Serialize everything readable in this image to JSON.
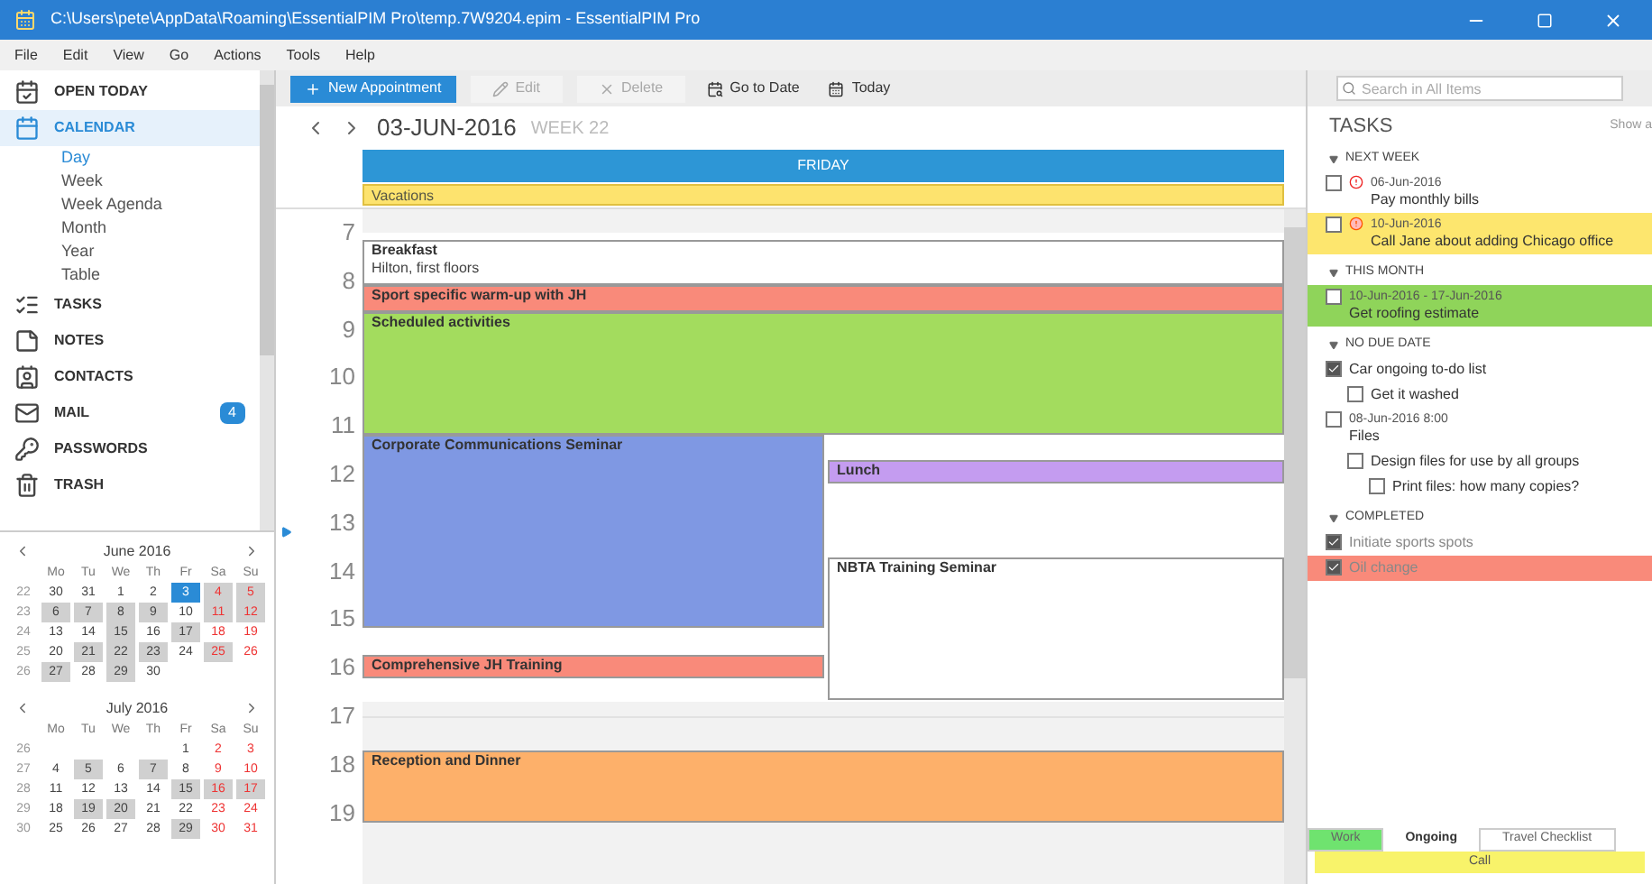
{
  "window": {
    "title": "C:\\Users\\pete\\AppData\\Roaming\\EssentialPIM Pro\\temp.7W9204.epim - EssentialPIM Pro"
  },
  "menu": [
    "File",
    "Edit",
    "View",
    "Go",
    "Actions",
    "Tools",
    "Help"
  ],
  "sidebar": {
    "items": [
      {
        "label": "OPEN TODAY",
        "kind": "module",
        "selected": false
      },
      {
        "label": "CALENDAR",
        "kind": "module",
        "selected": true
      },
      {
        "label": "Day",
        "kind": "view",
        "selected": true
      },
      {
        "label": "Week",
        "kind": "view",
        "selected": false
      },
      {
        "label": "Week Agenda",
        "kind": "view",
        "selected": false
      },
      {
        "label": "Month",
        "kind": "view",
        "selected": false
      },
      {
        "label": "Year",
        "kind": "view",
        "selected": false
      },
      {
        "label": "Table",
        "kind": "view",
        "selected": false
      },
      {
        "label": "TASKS",
        "kind": "module",
        "selected": false
      },
      {
        "label": "NOTES",
        "kind": "module",
        "selected": false
      },
      {
        "label": "CONTACTS",
        "kind": "module",
        "selected": false
      },
      {
        "label": "MAIL",
        "kind": "module",
        "selected": false,
        "badge": "4"
      },
      {
        "label": "PASSWORDS",
        "kind": "module",
        "selected": false
      },
      {
        "label": "TRASH",
        "kind": "module",
        "selected": false
      }
    ]
  },
  "mini_calendars": [
    {
      "title": "June 2016",
      "weekdays": [
        "Mo",
        "Tu",
        "We",
        "Th",
        "Fr",
        "Sa",
        "Su"
      ],
      "weeks": [
        {
          "week": "22",
          "days": [
            {
              "d": "30",
              "selected": false,
              "busy": false
            },
            {
              "d": "31",
              "selected": false,
              "busy": false
            },
            {
              "d": "1",
              "selected": false,
              "busy": false
            },
            {
              "d": "2",
              "selected": false,
              "busy": false
            },
            {
              "d": "3",
              "selected": true
            },
            {
              "d": "4",
              "selected": false,
              "busy": true
            },
            {
              "d": "5",
              "selected": false,
              "busy": true
            }
          ]
        },
        {
          "week": "23",
          "days": [
            {
              "d": "6",
              "selected": false,
              "busy": true
            },
            {
              "d": "7",
              "selected": false,
              "busy": true
            },
            {
              "d": "8",
              "selected": false,
              "busy": true
            },
            {
              "d": "9",
              "selected": false,
              "busy": true
            },
            {
              "d": "10",
              "selected": false,
              "busy": false
            },
            {
              "d": "11",
              "selected": false,
              "busy": true
            },
            {
              "d": "12",
              "selected": false,
              "busy": true
            }
          ]
        },
        {
          "week": "24",
          "days": [
            {
              "d": "13",
              "selected": false,
              "busy": false
            },
            {
              "d": "14",
              "selected": false,
              "busy": false
            },
            {
              "d": "15",
              "selected": false,
              "busy": true
            },
            {
              "d": "16",
              "selected": false,
              "busy": false
            },
            {
              "d": "17",
              "selected": false,
              "busy": true
            },
            {
              "d": "18",
              "selected": false,
              "busy": false
            },
            {
              "d": "19",
              "selected": false,
              "busy": false
            }
          ]
        },
        {
          "week": "25",
          "days": [
            {
              "d": "20",
              "selected": false,
              "busy": false
            },
            {
              "d": "21",
              "selected": false,
              "busy": true
            },
            {
              "d": "22",
              "selected": false,
              "busy": true
            },
            {
              "d": "23",
              "selected": false,
              "busy": true
            },
            {
              "d": "24",
              "selected": false,
              "busy": false
            },
            {
              "d": "25",
              "selected": false,
              "busy": true
            },
            {
              "d": "26",
              "selected": false,
              "busy": false
            }
          ]
        },
        {
          "week": "26",
          "days": [
            {
              "d": "27",
              "selected": false,
              "busy": true
            },
            {
              "d": "28",
              "selected": false,
              "busy": false
            },
            {
              "d": "29",
              "selected": false,
              "busy": true
            },
            {
              "d": "30",
              "selected": false,
              "busy": false
            }
          ]
        }
      ]
    },
    {
      "title": "July 2016",
      "weekdays": [
        "Mo",
        "Tu",
        "We",
        "Th",
        "Fr",
        "Sa",
        "Su"
      ],
      "weeks": [
        {
          "week": "26",
          "days": [
            {
              "d": "1",
              "selected": false,
              "busy": false
            },
            {
              "d": "2",
              "selected": false,
              "busy": false
            },
            {
              "d": "3",
              "selected": false,
              "busy": false
            }
          ]
        },
        {
          "week": "27",
          "days": [
            {
              "d": "4",
              "selected": false,
              "busy": false
            },
            {
              "d": "5",
              "selected": false,
              "busy": true
            },
            {
              "d": "6",
              "selected": false,
              "busy": false
            },
            {
              "d": "7",
              "selected": false,
              "busy": true
            },
            {
              "d": "8",
              "selected": false,
              "busy": false
            },
            {
              "d": "9",
              "selected": false,
              "busy": false
            },
            {
              "d": "10",
              "selected": false,
              "busy": false
            }
          ]
        },
        {
          "week": "28",
          "days": [
            {
              "d": "11",
              "selected": false,
              "busy": false
            },
            {
              "d": "12",
              "selected": false,
              "busy": false
            },
            {
              "d": "13",
              "selected": false,
              "busy": false
            },
            {
              "d": "14",
              "selected": false,
              "busy": false
            },
            {
              "d": "15",
              "selected": false,
              "busy": true
            },
            {
              "d": "16",
              "selected": false,
              "busy": true
            },
            {
              "d": "17",
              "selected": false,
              "busy": true
            }
          ]
        },
        {
          "week": "29",
          "days": [
            {
              "d": "18",
              "selected": false,
              "busy": false
            },
            {
              "d": "19",
              "selected": false,
              "busy": true
            },
            {
              "d": "20",
              "selected": false,
              "busy": true
            },
            {
              "d": "21",
              "selected": false,
              "busy": false
            },
            {
              "d": "22",
              "selected": false,
              "busy": false
            },
            {
              "d": "23",
              "selected": false,
              "busy": false
            },
            {
              "d": "24",
              "selected": false,
              "busy": false
            }
          ]
        },
        {
          "week": "30",
          "days": [
            {
              "d": "25",
              "selected": false,
              "busy": false
            },
            {
              "d": "26",
              "selected": false,
              "busy": false
            },
            {
              "d": "27",
              "selected": false,
              "busy": false
            },
            {
              "d": "28",
              "selected": false,
              "busy": false
            },
            {
              "d": "29",
              "selected": false,
              "busy": true
            },
            {
              "d": "30",
              "selected": false,
              "busy": false
            },
            {
              "d": "31",
              "selected": false,
              "busy": false
            }
          ]
        }
      ]
    }
  ],
  "toolbar": [
    {
      "label": "New Appointment",
      "kind": "primary",
      "disabled": false
    },
    {
      "label": "Edit",
      "kind": "edit",
      "disabled": true
    },
    {
      "label": "Delete",
      "kind": "delete",
      "disabled": true
    },
    {
      "label": "Go to Date",
      "kind": "goto",
      "disabled": false
    },
    {
      "label": "Today",
      "kind": "today",
      "disabled": false
    }
  ],
  "search": {
    "placeholder": "Search in All Items"
  },
  "calendar": {
    "date": "03-JUN-2016",
    "week": "WEEK 22",
    "day": "FRIDAY",
    "all_day": [
      {
        "title": "Vacations",
        "color": "#fde36e"
      }
    ],
    "hours": [
      "7",
      "8",
      "9",
      "10",
      "11",
      "12",
      "13",
      "14",
      "15",
      "16",
      "17",
      "18",
      "19"
    ],
    "events": [
      {
        "title": "Breakfast",
        "location": "Hilton, first floors",
        "color": "#ffffff"
      },
      {
        "title": "Sport specific warm-up with JH",
        "color": "#f98a7a"
      },
      {
        "title": "Scheduled activities",
        "color": "#a3dc5e"
      },
      {
        "title": "Corporate Communications Seminar",
        "color": "#7f98e3"
      },
      {
        "title": "Lunch",
        "color": "#c49cf0"
      },
      {
        "title": "NBTA Training Seminar",
        "color": "#ffffff"
      },
      {
        "title": "Comprehensive JH Training",
        "color": "#f98a7a"
      },
      {
        "title": "Reception and Dinner",
        "color": "#fdb06a"
      }
    ]
  },
  "tasks": {
    "title": "TASKS",
    "filter": "Show a",
    "groups": [
      {
        "title": "NEXT WEEK",
        "expanded": true,
        "items": [
          {
            "date": "06-Jun-2016",
            "title": "Pay monthly bills",
            "checked": false,
            "kind": "high"
          },
          {
            "date": "10-Jun-2016",
            "title": "Call Jane about adding Chicago office",
            "checked": false,
            "kind": "urgent",
            "color": "#fde66e"
          }
        ]
      },
      {
        "title": "THIS MONTH",
        "expanded": true,
        "items": [
          {
            "date": "10-Jun-2016 - 17-Jun-2016",
            "title": "Get roofing estimate",
            "checked": false,
            "kind": "plain",
            "color": "#8fd45a"
          }
        ]
      },
      {
        "title": "NO DUE DATE",
        "expanded": true,
        "items": [
          {
            "title": "Car ongoing to-do list",
            "checked": true,
            "kind": "plain",
            "children": [
              {
                "title": "Get it washed",
                "checked": false
              }
            ]
          },
          {
            "date": "08-Jun-2016 8:00",
            "title": "Files",
            "checked": false,
            "kind": "plain",
            "children": [
              {
                "title": "Design files for use by all groups",
                "checked": false,
                "children": [
                  {
                    "title": "Print files: how many copies?",
                    "checked": false
                  }
                ]
              }
            ]
          }
        ]
      },
      {
        "title": "COMPLETED",
        "expanded": true,
        "items": [
          {
            "title": "Initiate sports spots",
            "checked": true,
            "kind": "plain"
          },
          {
            "title": "Oil change",
            "checked": true,
            "kind": "plain",
            "color": "#f98a7a"
          }
        ]
      }
    ],
    "tabs": [
      {
        "label": "Work",
        "selected": false,
        "color": "#6fe36f"
      },
      {
        "label": "Ongoing",
        "selected": true
      },
      {
        "label": "Travel Checklist",
        "selected": false
      }
    ],
    "footer": "Call"
  }
}
